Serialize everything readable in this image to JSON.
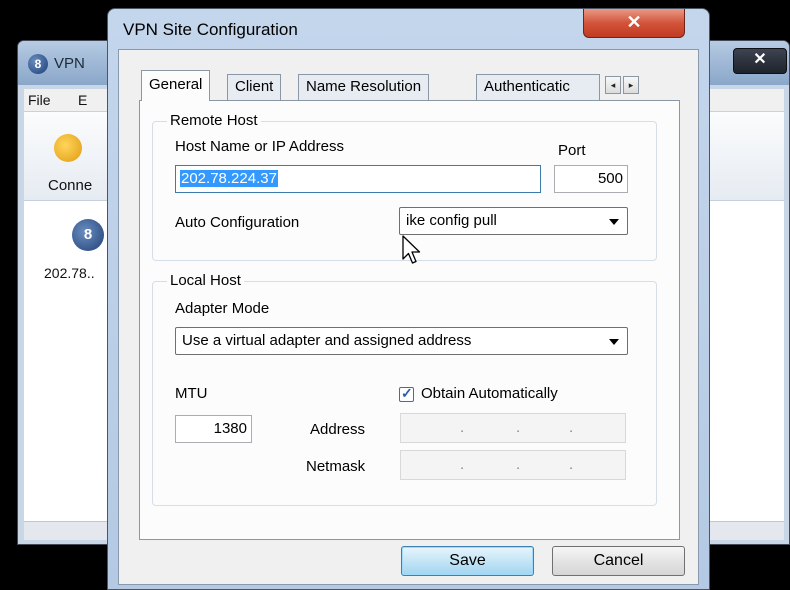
{
  "background_window": {
    "title": "VPN",
    "app_icon_glyph": "8",
    "close_glyph": "✕",
    "menu": [
      "File",
      "E"
    ],
    "toolbar": {
      "connect_label": "Conne"
    },
    "site": {
      "label": "202.78.."
    }
  },
  "dialog": {
    "title": "VPN Site Configuration",
    "close_glyph": "✕",
    "tabs": [
      "General",
      "Client",
      "Name Resolution",
      "Authenticatic"
    ],
    "tab_scroll": {
      "left": "◂",
      "right": "▸"
    },
    "remote_host": {
      "title": "Remote Host",
      "host_label": "Host Name or IP Address",
      "host_value": "202.78.224.37",
      "port_label": "Port",
      "port_value": "500",
      "auto_config_label": "Auto Configuration",
      "auto_config_value": "ike config pull"
    },
    "local_host": {
      "title": "Local Host",
      "adapter_mode_label": "Adapter Mode",
      "adapter_mode_value": "Use a virtual adapter and assigned address",
      "mtu_label": "MTU",
      "mtu_value": "1380",
      "obtain_label": "Obtain Automatically",
      "obtain_checked": true,
      "address_label": "Address",
      "netmask_label": "Netmask"
    },
    "buttons": {
      "save": "Save",
      "cancel": "Cancel"
    }
  },
  "colors": {
    "titlebar": "#c4d6ec",
    "selection": "#3399ff",
    "close_button": "#d2543a",
    "default_button": "#c4e5f6"
  }
}
